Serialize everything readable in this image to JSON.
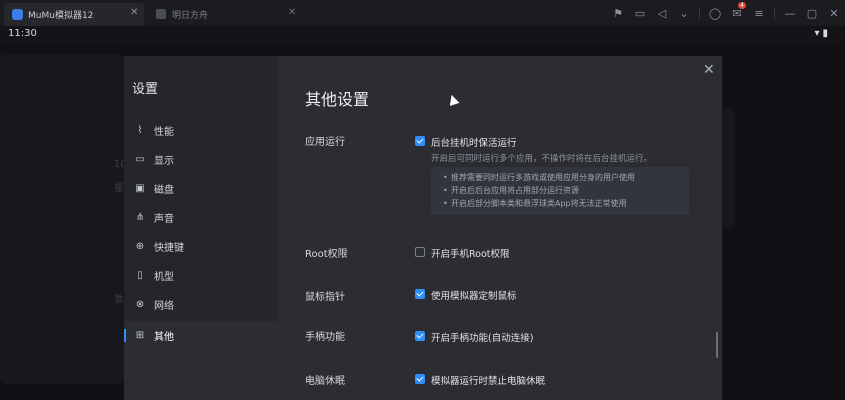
{
  "titlebar": {
    "app_title": "MuMu模拟器12",
    "second_tab": "明日方舟",
    "notification_count": "4"
  },
  "statusbar": {
    "time": "11:30"
  },
  "desktop": {
    "ghost_a": "10",
    "ghost_b": "星",
    "ghost_c": "激"
  },
  "settings": {
    "sidebar_title": "设置",
    "sidebar_items": [
      {
        "label": "性能",
        "icon": "performance-icon"
      },
      {
        "label": "显示",
        "icon": "display-icon"
      },
      {
        "label": "磁盘",
        "icon": "disk-icon"
      },
      {
        "label": "声音",
        "icon": "sound-icon"
      },
      {
        "label": "快捷键",
        "icon": "keyboard-icon"
      },
      {
        "label": "机型",
        "icon": "phone-icon"
      },
      {
        "label": "网络",
        "icon": "network-icon"
      },
      {
        "label": "其他",
        "icon": "grid-icon"
      }
    ],
    "content_title": "其他设置",
    "sections": {
      "app_run": {
        "label": "应用运行",
        "checkbox_label": "后台挂机时保活运行",
        "checked": true,
        "hint": "开启后可同时运行多个应用，不操作时将在后台挂机运行。",
        "bullets": [
          "推荐需要同时运行多游戏或使用应用分身的用户使用",
          "开启后后台应用将占用部分运行资源",
          "开启后部分脚本类和悬浮球类App将无法正常使用"
        ]
      },
      "root": {
        "label": "Root权限",
        "checkbox_label": "开启手机Root权限",
        "checked": false
      },
      "mouse": {
        "label": "鼠标指针",
        "checkbox_label": "使用模拟器定制鼠标",
        "checked": true
      },
      "gamepad": {
        "label": "手柄功能",
        "checkbox_label": "开启手柄功能(自动连接)",
        "checked": true
      },
      "sleep": {
        "label": "电脑休眠",
        "checkbox_label": "模拟器运行时禁止电脑休眠",
        "checked": true
      }
    }
  },
  "colors": {
    "accent": "#2f8ef7",
    "dialog_bg": "#2b2d33",
    "sidebar_bg": "#24262b"
  }
}
